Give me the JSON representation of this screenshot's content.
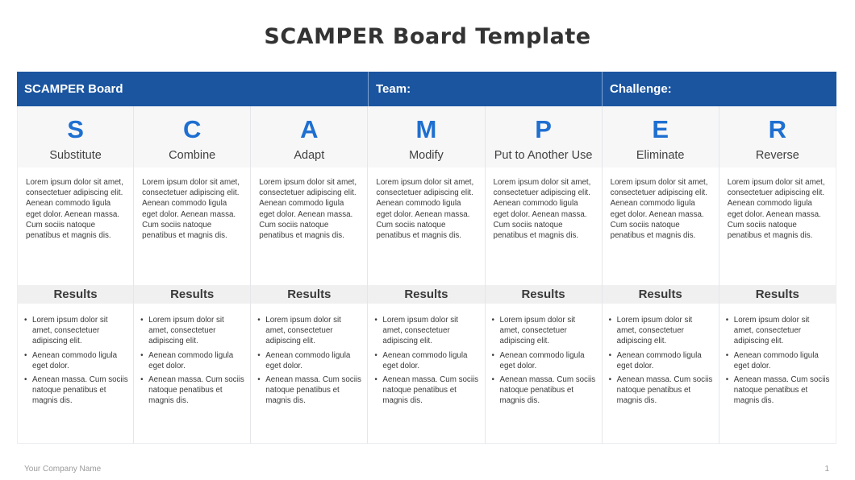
{
  "title": "SCAMPER Board Template",
  "header": {
    "board_label": "SCAMPER Board",
    "team_label": "Team:",
    "challenge_label": "Challenge:"
  },
  "columns": [
    {
      "letter": "S",
      "word": "Substitute",
      "description": "Lorem  ipsum dolor sit amet, consectetuer adipiscing elit. Aenean commodo ligula eget dolor. Aenean massa. Cum sociis natoque penatibus et magnis dis.",
      "results_label": "Results",
      "results": [
        "Lorem  ipsum dolor sit amet, consectetuer adipiscing elit.",
        "Aenean commodo ligula eget  dolor.",
        "Aenean massa. Cum sociis natoque penatibus et magnis dis."
      ]
    },
    {
      "letter": "C",
      "word": "Combine",
      "description": "Lorem  ipsum dolor sit amet, consectetuer adipiscing elit. Aenean commodo ligula eget dolor. Aenean massa. Cum sociis natoque penatibus et magnis dis.",
      "results_label": "Results",
      "results": [
        "Lorem  ipsum dolor sit amet, consectetuer adipiscing elit.",
        "Aenean commodo ligula eget  dolor.",
        "Aenean massa. Cum sociis natoque penatibus et magnis dis."
      ]
    },
    {
      "letter": "A",
      "word": "Adapt",
      "description": "Lorem  ipsum dolor sit amet, consectetuer adipiscing elit. Aenean commodo ligula eget dolor. Aenean massa. Cum sociis natoque penatibus et magnis dis.",
      "results_label": "Results",
      "results": [
        "Lorem  ipsum dolor sit amet, consectetuer adipiscing elit.",
        "Aenean commodo ligula eget  dolor.",
        "Aenean massa. Cum sociis natoque penatibus et magnis dis."
      ]
    },
    {
      "letter": "M",
      "word": "Modify",
      "description": "Lorem  ipsum dolor sit amet, consectetuer adipiscing elit. Aenean commodo ligula eget dolor. Aenean massa. Cum sociis natoque penatibus et magnis dis.",
      "results_label": "Results",
      "results": [
        "Lorem  ipsum dolor sit amet, consectetuer adipiscing elit.",
        "Aenean commodo ligula eget  dolor.",
        "Aenean massa. Cum sociis natoque penatibus et magnis dis."
      ]
    },
    {
      "letter": "P",
      "word": "Put to  Another Use",
      "description": "Lorem  ipsum dolor sit amet, consectetuer adipiscing elit. Aenean commodo ligula eget dolor. Aenean massa. Cum sociis natoque penatibus et magnis dis.",
      "results_label": "Results",
      "results": [
        "Lorem  ipsum dolor sit amet, consectetuer adipiscing elit.",
        "Aenean commodo ligula eget  dolor.",
        "Aenean massa. Cum sociis natoque penatibus et magnis dis."
      ]
    },
    {
      "letter": "E",
      "word": "Eliminate",
      "description": "Lorem  ipsum dolor sit amet, consectetuer adipiscing elit. Aenean commodo ligula eget dolor. Aenean massa. Cum sociis natoque penatibus et magnis dis.",
      "results_label": "Results",
      "results": [
        "Lorem  ipsum dolor sit amet, consectetuer adipiscing elit.",
        "Aenean commodo ligula eget  dolor.",
        "Aenean massa. Cum sociis natoque penatibus et magnis dis."
      ]
    },
    {
      "letter": "R",
      "word": "Reverse",
      "description": "Lorem  ipsum dolor sit amet, consectetuer adipiscing elit. Aenean commodo ligula eget dolor. Aenean massa. Cum sociis natoque penatibus et magnis dis.",
      "results_label": "Results",
      "results": [
        "Lorem  ipsum dolor sit amet, consectetuer adipiscing elit.",
        "Aenean commodo ligula eget  dolor.",
        "Aenean massa. Cum sociis natoque penatibus et magnis dis."
      ]
    }
  ],
  "footer": {
    "company": "Your Company  Name",
    "page_number": "1"
  },
  "colors": {
    "header_bg": "#1b55a0",
    "letter_color": "#1e6fd0"
  }
}
